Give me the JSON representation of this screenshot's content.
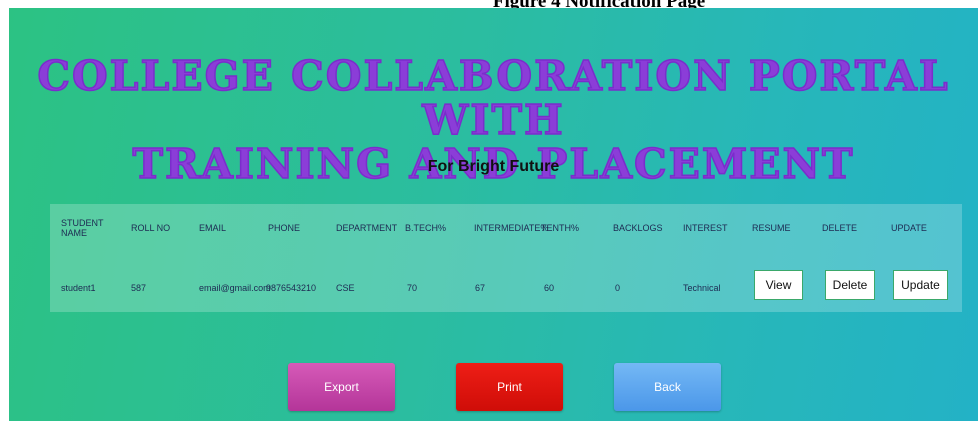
{
  "caption": "Figure 4 Notification Page",
  "header": {
    "title_line1": "COLLEGE COLLABORATION PORTAL WITH",
    "title_line2": "TRAINING AND PLACEMENT",
    "subtitle": "For Bright Future"
  },
  "table": {
    "headers": [
      "STUDENT NAME",
      "ROLL NO",
      "EMAIL",
      "PHONE",
      "DEPARTMENT",
      "B.TECH%",
      "INTERMEDIATE%",
      "TENTH%",
      "BACKLOGS",
      "INTEREST",
      "RESUME",
      "DELETE",
      "UPDATE"
    ],
    "rows": [
      {
        "student_name": "student1",
        "roll_no": "587",
        "email": "email@gmail.com",
        "phone": "9876543210",
        "department": "CSE",
        "btech": "70",
        "intermediate": "67",
        "tenth": "60",
        "backlogs": "0",
        "interest": "Technical",
        "view_label": "View",
        "delete_label": "Delete",
        "update_label": "Update"
      }
    ]
  },
  "actions": {
    "export_label": "Export",
    "print_label": "Print",
    "back_label": "Back"
  }
}
